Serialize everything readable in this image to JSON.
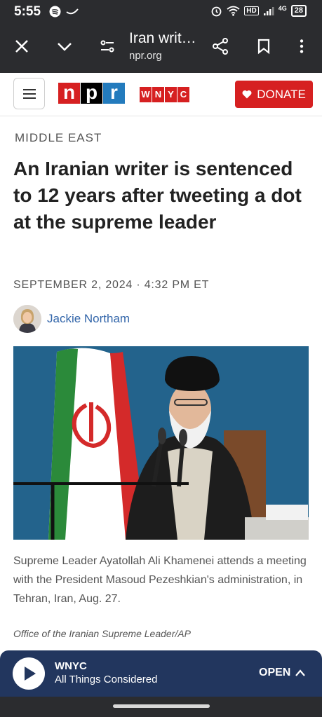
{
  "status_bar": {
    "time": "5:55",
    "network": "HD",
    "signal": "4G",
    "battery": "28"
  },
  "browser": {
    "title": "Iran writ…",
    "domain": "npr.org"
  },
  "header": {
    "npr_letters": [
      "n",
      "p",
      "r"
    ],
    "wnyc_letters": [
      "W",
      "N",
      "Y",
      "C"
    ],
    "donate_label": "DONATE"
  },
  "article": {
    "section": "MIDDLE EAST",
    "headline": "An Iranian writer is sentenced to 12 years after tweeting a dot at the supreme leader",
    "dateline": "SEPTEMBER 2, 2024 · 4:32 PM ET",
    "author": "Jackie Northam",
    "caption": "Supreme Leader Ayatollah Ali Khamenei attends a meeting with the President Masoud Pezeshkian's administration, in Tehran, Iran, Aug. 27.",
    "credit": "Office of the Iranian Supreme Leader/AP"
  },
  "player": {
    "station": "WNYC",
    "program": "All Things Considered",
    "open_label": "OPEN"
  },
  "colors": {
    "npr_red": "#d62021",
    "npr_black": "#000000",
    "npr_blue": "#237bbd",
    "player_bg": "#22365e",
    "link": "#3366aa"
  },
  "icons": {
    "browser": [
      "close-icon",
      "chevron-down-icon",
      "site-settings-icon",
      "share-icon",
      "bookmark-icon",
      "more-vert-icon"
    ],
    "player": [
      "play-icon",
      "chevron-up-icon"
    ]
  }
}
